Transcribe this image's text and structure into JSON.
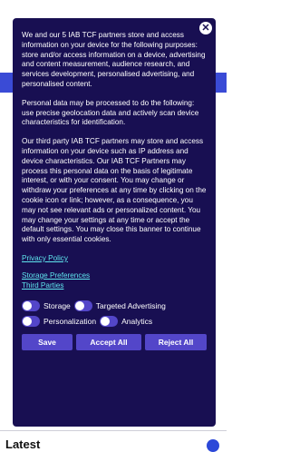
{
  "banner": {
    "close_symbol": "✕",
    "paragraphs": [
      "We and our 5 IAB TCF partners store and access information on your device for the following purposes: store and/or access information on a device, advertising and content measurement, audience research, and services development, personalised advertising, and personalised content.",
      "Personal data may be processed to do the following: use precise geolocation data and actively scan device characteristics for identification.",
      "Our third party IAB TCF partners may store and access information on your device such as IP address and device characteristics. Our IAB TCF Partners may process this personal data on the basis of legitimate interest, or with your consent. You may change or withdraw your preferences at any time by clicking on the cookie icon or link; however, as a consequence, you may not see relevant ads or personalized content. You may change your settings at any time or accept the default settings. You may close this banner to continue with only essential cookies."
    ],
    "links": {
      "privacy_policy": "Privacy Policy",
      "storage_preferences": "Storage Preferences",
      "third_parties": "Third Parties"
    },
    "toggles": {
      "storage": "Storage",
      "targeted_advertising": "Targeted Advertising",
      "personalization": "Personalization",
      "analytics": "Analytics"
    },
    "buttons": {
      "save": "Save",
      "accept_all": "Accept All",
      "reject_all": "Reject All"
    }
  },
  "background": {
    "footer_text": "Latest"
  },
  "colors": {
    "banner_bg": "#180f52",
    "button_bg": "#5346c9",
    "link": "#5fe6ee",
    "brand_band": "#3a4bd6"
  }
}
